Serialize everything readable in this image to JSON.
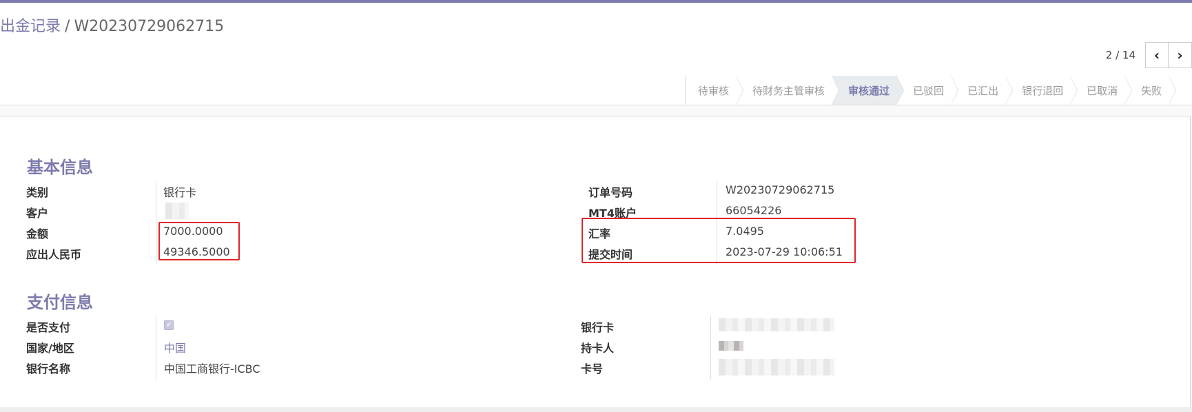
{
  "breadcrumb": {
    "parent": "出金记录",
    "separator": "/",
    "current": "W20230729062715"
  },
  "pager": {
    "value": "2 / 14",
    "prev_glyph": "‹",
    "next_glyph": "›"
  },
  "statusbar": {
    "stages": [
      "待审核",
      "待财务主管审核",
      "审核通过",
      "已驳回",
      "已汇出",
      "银行退回",
      "已取消",
      "失败"
    ],
    "active": "审核通过"
  },
  "basic_info": {
    "title": "基本信息",
    "left": [
      {
        "label": "类别",
        "value": "银行卡"
      },
      {
        "label": "客户",
        "value": ""
      },
      {
        "label": "金额",
        "value": "7000.0000"
      },
      {
        "label": "应出人民币",
        "value": "49346.5000"
      }
    ],
    "right": [
      {
        "label": "订单号码",
        "value": "W20230729062715"
      },
      {
        "label": "MT4账户",
        "value": "66054226"
      },
      {
        "label": "汇率",
        "value": "7.0495"
      },
      {
        "label": "提交时间",
        "value": "2023-07-29 10:06:51"
      }
    ]
  },
  "payment_info": {
    "title": "支付信息",
    "left": [
      {
        "label": "是否支付",
        "value": "✔"
      },
      {
        "label": "国家/地区",
        "value": "中国"
      },
      {
        "label": "银行名称",
        "value": "中国工商银行-ICBC"
      }
    ],
    "right": [
      {
        "label": "银行卡",
        "value": ""
      },
      {
        "label": "持卡人",
        "value": ""
      },
      {
        "label": "卡号",
        "value": ""
      }
    ]
  },
  "colors": {
    "accent": "#7c7bad",
    "highlight_box": "#e0242a"
  }
}
